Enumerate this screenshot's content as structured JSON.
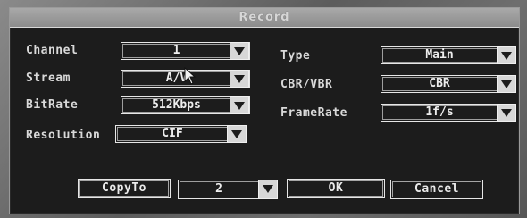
{
  "window": {
    "title": "Record"
  },
  "fields": {
    "channel": {
      "label": "Channel",
      "value": "1"
    },
    "stream": {
      "label": "Stream",
      "value": "A/V"
    },
    "bitrate": {
      "label": "BitRate",
      "value": "512Kbps"
    },
    "resolution": {
      "label": "Resolution",
      "value": "CIF"
    },
    "type": {
      "label": "Type",
      "value": "Main"
    },
    "cbr_vbr": {
      "label": "CBR/VBR",
      "value": "CBR"
    },
    "framerate": {
      "label": "FrameRate",
      "value": "1f/s"
    }
  },
  "footer": {
    "copy_to_label": "CopyTo",
    "copy_target_value": "2",
    "ok_label": "OK",
    "cancel_label": "Cancel"
  },
  "icons": {
    "dropdown": "chevron-down-icon",
    "pointer": "mouse-cursor-icon"
  },
  "colors": {
    "dialog_bg": "#1c1c1c",
    "title_bar": "#9a9a9a",
    "text": "#e0e0e0"
  }
}
